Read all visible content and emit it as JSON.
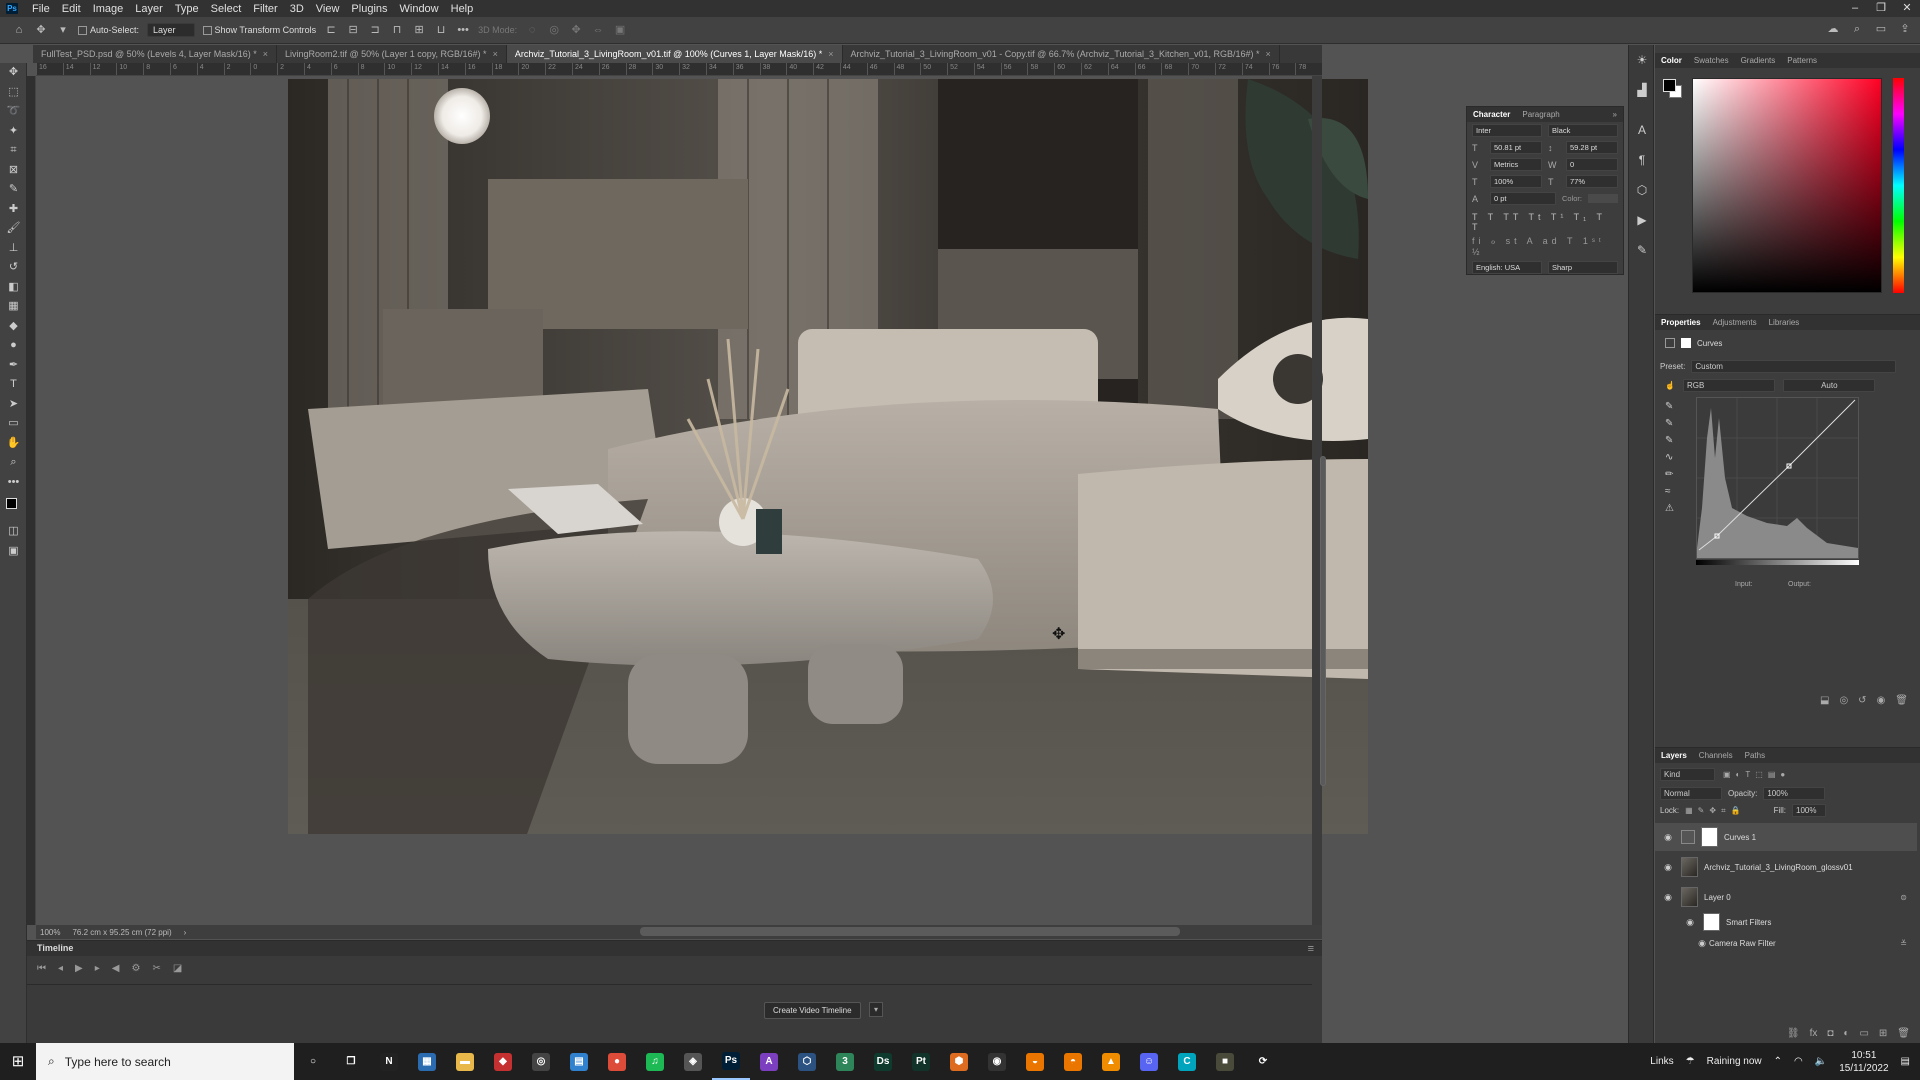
{
  "app": {
    "logo": "Ps"
  },
  "menu": [
    "File",
    "Edit",
    "Image",
    "Layer",
    "Type",
    "Select",
    "Filter",
    "3D",
    "View",
    "Plugins",
    "Window",
    "Help"
  ],
  "options": {
    "auto_select_label": "Auto-Select:",
    "auto_select_value": "Layer",
    "transform_label": "Show Transform Controls",
    "mode3d": "3D Mode:"
  },
  "tabs": [
    {
      "title": "FullTest_PSD.psd @ 50% (Levels 4, Layer Mask/16) *",
      "active": false
    },
    {
      "title": "LivingRoom2.tif @ 50% (Layer 1 copy, RGB/16#) *",
      "active": false
    },
    {
      "title": "Archviz_Tutorial_3_LivingRoom_v01.tif @ 100% (Curves 1, Layer Mask/16) *",
      "active": true
    },
    {
      "title": "Archviz_Tutorial_3_LivingRoom_v01 - Copy.tif @ 66.7% (Archviz_Tutorial_3_Kitchen_v01, RGB/16#) *",
      "active": false
    }
  ],
  "ruler_ticks": [
    "16",
    "14",
    "12",
    "10",
    "8",
    "6",
    "4",
    "2",
    "0",
    "2",
    "4",
    "6",
    "8",
    "10",
    "12",
    "14",
    "16",
    "18",
    "20",
    "22",
    "24",
    "26",
    "28",
    "30",
    "32",
    "34",
    "36",
    "38",
    "40",
    "42",
    "44",
    "46",
    "48",
    "50",
    "52",
    "54",
    "56",
    "58",
    "60",
    "62",
    "64",
    "66",
    "68",
    "70",
    "72",
    "74",
    "76",
    "78",
    "80",
    "82",
    "84",
    "86"
  ],
  "status": {
    "zoom": "100%",
    "doc_size": "76.2 cm x 95.25 cm (72 ppi)"
  },
  "timeline": {
    "title": "Timeline",
    "create_button": "Create Video Timeline"
  },
  "character": {
    "tabs": [
      "Character",
      "Paragraph"
    ],
    "font": "Inter",
    "style": "Black",
    "size": "50.81 pt",
    "leading": "59.28 pt",
    "kerning": "Metrics",
    "tracking": "0",
    "vscale": "100%",
    "hscale": "77%",
    "baseline": "0 pt",
    "color_label": "Color:",
    "language": "English: USA",
    "aa": "Sharp"
  },
  "color_panel": {
    "tabs": [
      "Color",
      "Swatches",
      "Gradients",
      "Patterns"
    ]
  },
  "properties": {
    "tabs": [
      "Properties",
      "Adjustments",
      "Libraries"
    ],
    "type": "Curves",
    "preset_label": "Preset:",
    "preset": "Custom",
    "channel": "RGB",
    "auto": "Auto",
    "input_label": "Input:",
    "output_label": "Output:"
  },
  "layers": {
    "tabs": [
      "Layers",
      "Channels",
      "Paths"
    ],
    "kind": "Kind",
    "blend": "Normal",
    "opacity_label": "Opacity:",
    "opacity": "100%",
    "lock_label": "Lock:",
    "fill_label": "Fill:",
    "fill": "100%",
    "items": [
      {
        "name": "Curves 1",
        "selected": true
      },
      {
        "name": "Archviz_Tutorial_3_LivingRoom_glossv01",
        "selected": false
      },
      {
        "name": "Layer 0",
        "selected": false
      },
      {
        "name": "Smart Filters",
        "selected": false
      },
      {
        "name": "Camera Raw Filter",
        "selected": false
      }
    ]
  },
  "taskbar": {
    "search_placeholder": "Type here to search",
    "apps": [
      {
        "icon": "cortana-icon",
        "glyph": "○",
        "color": "transparent"
      },
      {
        "icon": "task-view-icon",
        "glyph": "❐",
        "color": "transparent"
      },
      {
        "icon": "notion-icon",
        "glyph": "N",
        "color": "#222"
      },
      {
        "icon": "calculator-icon",
        "glyph": "▦",
        "color": "#2b6cb0"
      },
      {
        "icon": "file-explorer-icon",
        "glyph": "▬",
        "color": "#e8b84a"
      },
      {
        "icon": "app-red-icon",
        "glyph": "◆",
        "color": "#c53030"
      },
      {
        "icon": "app-dark-icon",
        "glyph": "◎",
        "color": "#444"
      },
      {
        "icon": "app-blue-icon",
        "glyph": "▤",
        "color": "#3182ce"
      },
      {
        "icon": "chrome-icon",
        "glyph": "●",
        "color": "#dd4b39"
      },
      {
        "icon": "spotify-icon",
        "glyph": "♫",
        "color": "#1db954"
      },
      {
        "icon": "app-gray-icon",
        "glyph": "◈",
        "color": "#555"
      },
      {
        "icon": "photoshop-icon",
        "glyph": "Ps",
        "color": "#001e36",
        "active": true
      },
      {
        "icon": "affinity-icon",
        "glyph": "A",
        "color": "#7b3fbf"
      },
      {
        "icon": "app-cube-icon",
        "glyph": "⬡",
        "color": "#2c5282"
      },
      {
        "icon": "app-3-icon",
        "glyph": "3",
        "color": "#2f855a"
      },
      {
        "icon": "designer-icon",
        "glyph": "Ds",
        "color": "#0f3b2e"
      },
      {
        "icon": "painter-icon",
        "glyph": "Pt",
        "color": "#12332a"
      },
      {
        "icon": "app-box-icon",
        "glyph": "⬢",
        "color": "#dd6b20"
      },
      {
        "icon": "obs-icon",
        "glyph": "◉",
        "color": "#333"
      },
      {
        "icon": "blender-icon",
        "glyph": "◒",
        "color": "#ea7600"
      },
      {
        "icon": "blender2-icon",
        "glyph": "◓",
        "color": "#ea7600"
      },
      {
        "icon": "vlc-icon",
        "glyph": "▲",
        "color": "#f08c00"
      },
      {
        "icon": "discord-icon",
        "glyph": "☺",
        "color": "#5865f2"
      },
      {
        "icon": "app-c-icon",
        "glyph": "C",
        "color": "#00a4bd"
      },
      {
        "icon": "app-square-icon",
        "glyph": "■",
        "color": "#4a4a3a"
      },
      {
        "icon": "sync-icon",
        "glyph": "⟳",
        "color": "transparent"
      }
    ],
    "links": "Links",
    "weather": "Raining now",
    "time": "10:51",
    "date": "15/11/2022"
  },
  "colors": {
    "accent": "#31a8ff",
    "panel": "#3d3d3d",
    "bar": "#323232"
  }
}
